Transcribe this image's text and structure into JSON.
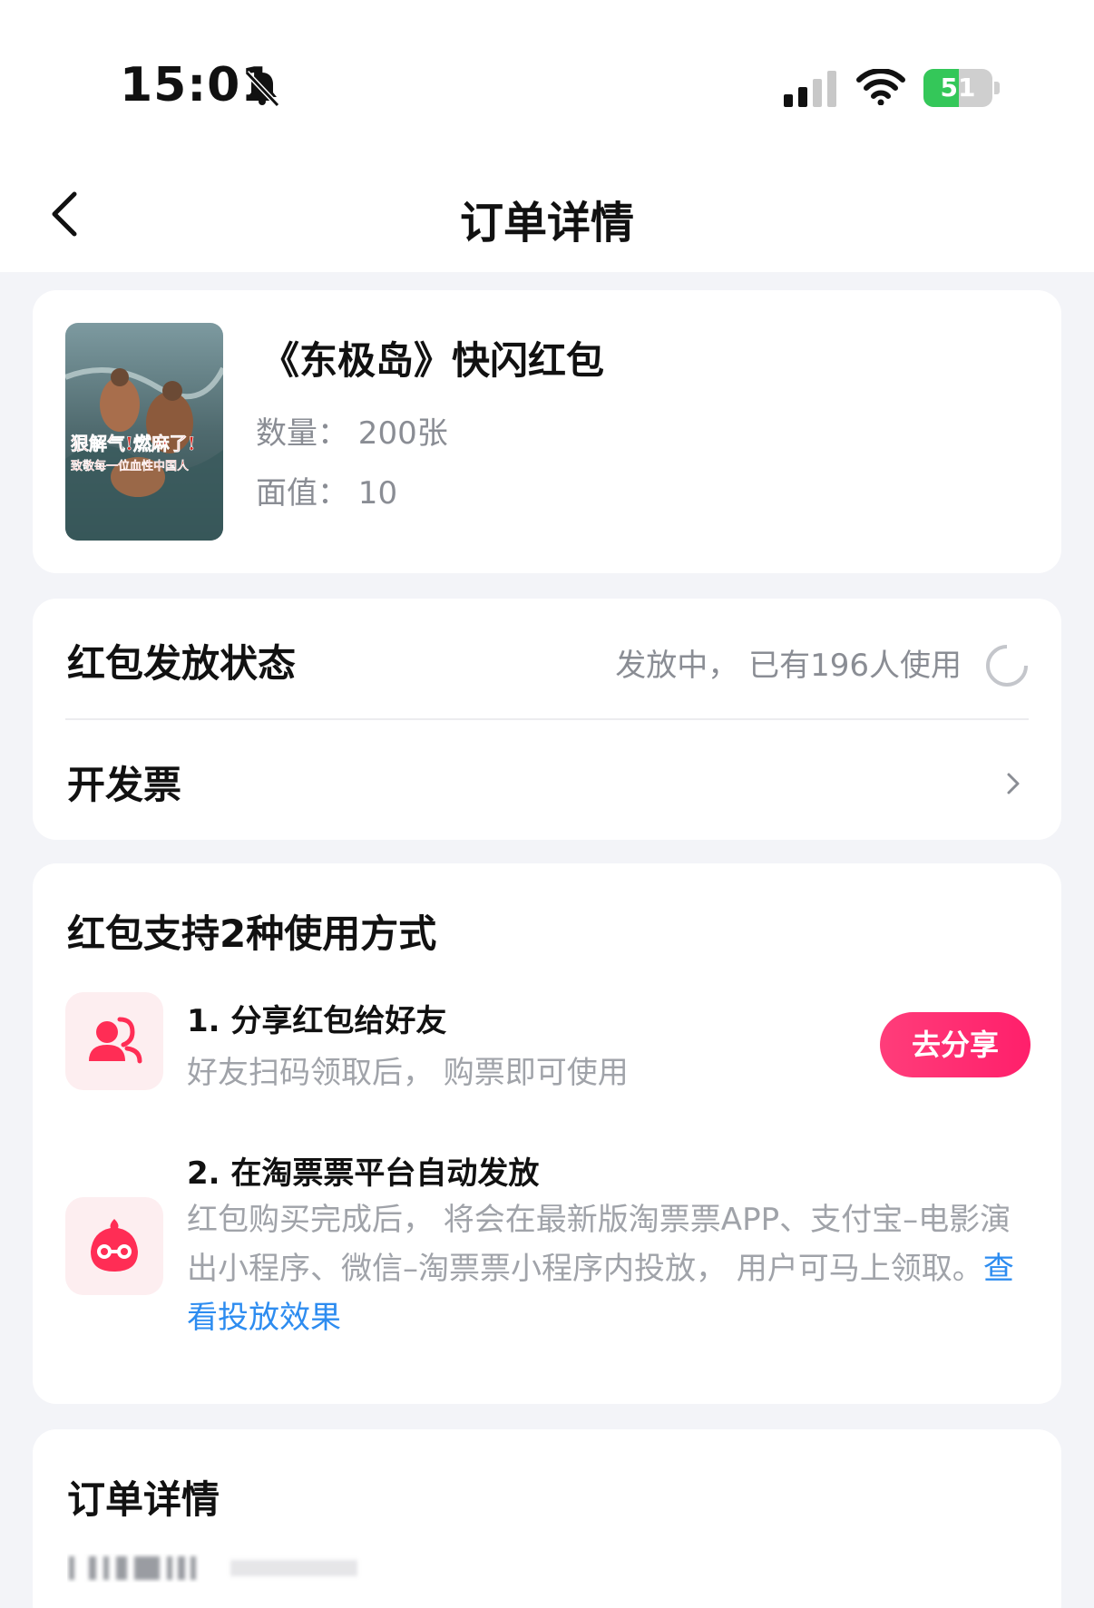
{
  "status_bar": {
    "time": "15:01",
    "battery_level": "51",
    "battery_fraction": 0.51,
    "icons": [
      "bell-muted-icon",
      "signal-icon",
      "wifi-icon",
      "battery-icon"
    ]
  },
  "nav": {
    "title": "订单详情",
    "back_icon": "chevron-left-icon"
  },
  "product": {
    "title": "《东极岛》快闪红包",
    "quantity": "数量：  200张",
    "face_value": "面值：  10",
    "poster_text_line1": "狠解气!燃麻了!",
    "poster_text_line2": "致敬每一位血性中国人"
  },
  "distribution": {
    "label": "红包发放状态",
    "status": "发放中，  已有196人使用",
    "invoice_label": "开发票"
  },
  "usage": {
    "title": "红包支持2种使用方式",
    "methods": [
      {
        "title": "1.  分享红包给好友",
        "desc": "好友扫码领取后，  购票即可使用",
        "icon": "friends-icon",
        "button": "去分享"
      },
      {
        "title": "2.  在淘票票平台自动发放",
        "desc": "红包购买完成后，  将会在最新版淘票票APP、支付宝–电影演出小程序、微信–淘票票小程序内投放，  用户可马上领取。",
        "link": "查看投放效果",
        "icon": "taopiaopiao-icon"
      }
    ]
  },
  "order_details": {
    "title": "订单详情"
  },
  "colors": {
    "accent": "#ff1f6b",
    "link": "#2d8cf0",
    "muted_text": "#8a8d94",
    "icon_bg": "#fdeef0",
    "battery_green": "#34c759"
  }
}
